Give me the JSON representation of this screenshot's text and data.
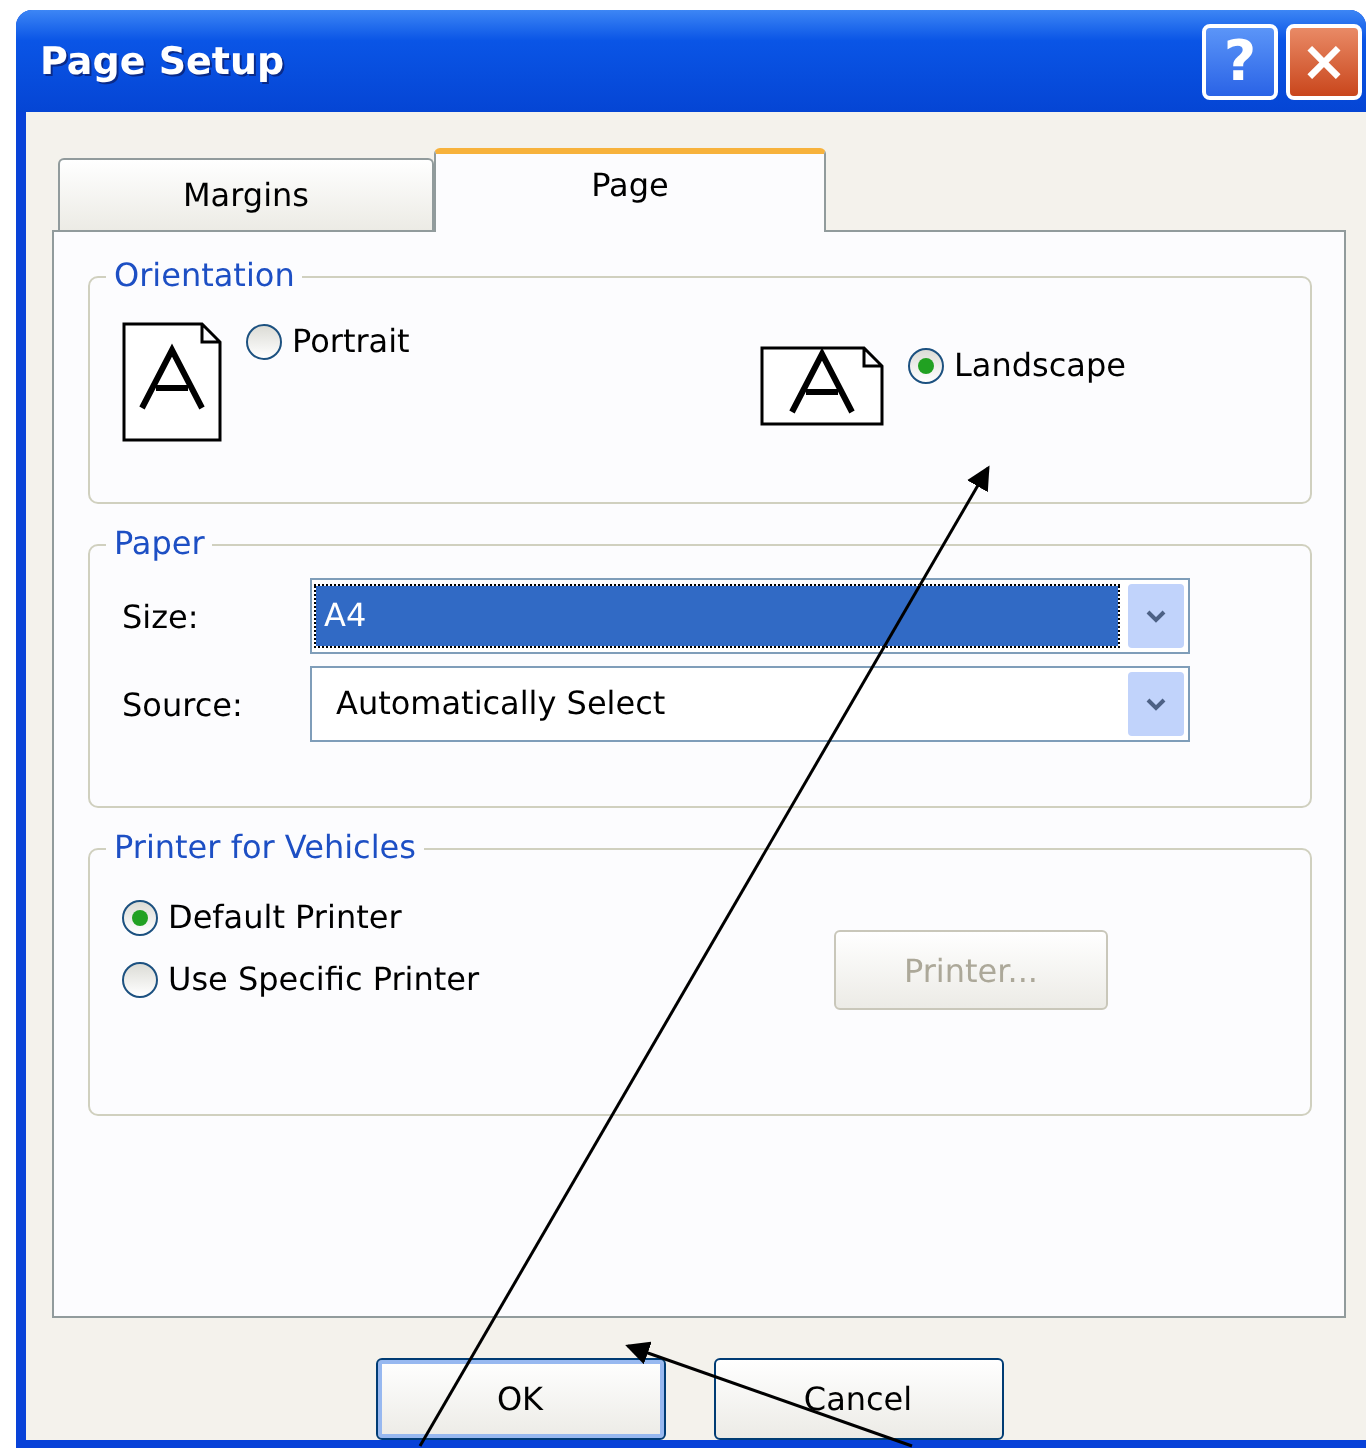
{
  "window": {
    "title": "Page Setup",
    "controls": [
      {
        "kind": "help",
        "label": "?"
      },
      {
        "kind": "close",
        "label": "×"
      }
    ]
  },
  "tabs": [
    {
      "label": "Margins",
      "selected": false
    },
    {
      "label": "Page",
      "selected": true
    }
  ],
  "orientation": {
    "title": "Orientation",
    "options": [
      {
        "label": "Portrait",
        "kind": "portrait",
        "selected": false
      },
      {
        "label": "Landscape",
        "kind": "landscape",
        "selected": true
      }
    ]
  },
  "paper": {
    "title": "Paper",
    "fields": [
      {
        "label": "Size:",
        "value": "A4",
        "focused": true
      },
      {
        "label": "Source:",
        "value": "Automatically Select",
        "focused": false
      }
    ]
  },
  "printer": {
    "title": "Printer for Vehicles",
    "options": [
      {
        "label": "Default Printer",
        "selected": true
      },
      {
        "label": "Use Specific Printer",
        "selected": false
      }
    ],
    "button": {
      "label": "Printer...",
      "disabled": true
    }
  },
  "buttons": [
    {
      "label": "OK",
      "default": true
    },
    {
      "label": "Cancel",
      "default": false
    }
  ]
}
